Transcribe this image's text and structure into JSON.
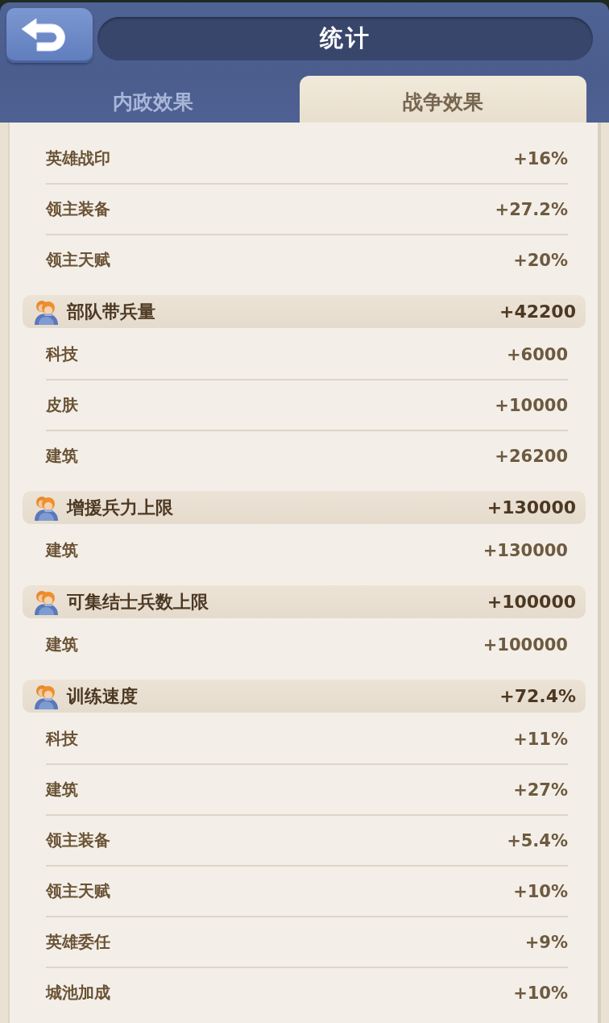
{
  "window": {
    "title": "统计"
  },
  "tabs": [
    {
      "label": "内政效果",
      "selected": false
    },
    {
      "label": "战争效果",
      "selected": true
    }
  ],
  "sections": [
    {
      "rows": [
        {
          "label": "英雄战印",
          "value": "+16%"
        },
        {
          "label": "领主装备",
          "value": "+27.2%"
        },
        {
          "label": "领主天赋",
          "value": "+20%"
        }
      ]
    },
    {
      "title": "部队带兵量",
      "total": "+42200",
      "rows": [
        {
          "label": "科技",
          "value": "+6000"
        },
        {
          "label": "皮肤",
          "value": "+10000"
        },
        {
          "label": "建筑",
          "value": "+26200"
        }
      ]
    },
    {
      "title": "增援兵力上限",
      "total": "+130000",
      "rows": [
        {
          "label": "建筑",
          "value": "+130000"
        }
      ]
    },
    {
      "title": "可集结士兵数上限",
      "total": "+100000",
      "rows": [
        {
          "label": "建筑",
          "value": "+100000"
        }
      ]
    },
    {
      "title": "训练速度",
      "total": "+72.4%",
      "rows": [
        {
          "label": "科技",
          "value": "+11%"
        },
        {
          "label": "建筑",
          "value": "+27%"
        },
        {
          "label": "领主装备",
          "value": "+5.4%"
        },
        {
          "label": "领主天赋",
          "value": "+10%"
        },
        {
          "label": "英雄委任",
          "value": "+9%"
        },
        {
          "label": "城池加成",
          "value": "+10%"
        }
      ]
    }
  ]
}
